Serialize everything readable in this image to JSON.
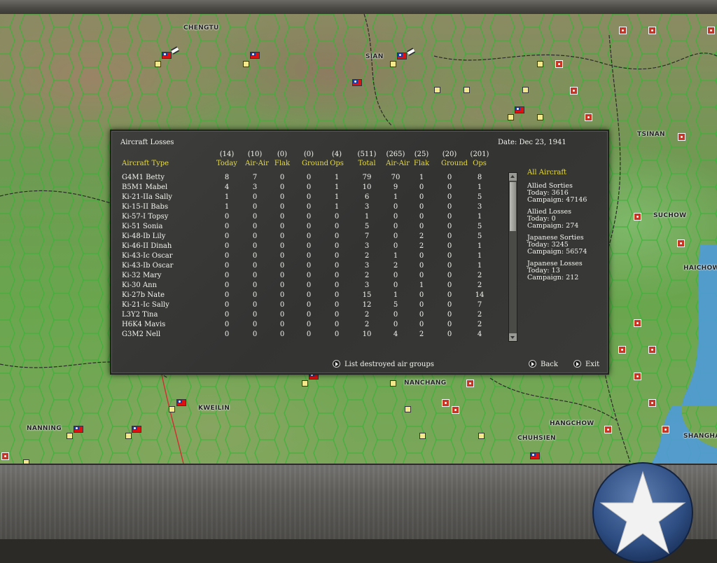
{
  "map": {
    "cities": [
      "CHENGTU",
      "SIAN",
      "TSINAN",
      "SUCHOW",
      "HAICHOW",
      "KWEILIN",
      "NANNING",
      "HANGCHOW",
      "CHUHSIEN",
      "SHANGHAI",
      "NANCHANG"
    ]
  },
  "dialog": {
    "title": "Aircraft Losses",
    "date": "Date: Dec 23, 1941",
    "header": {
      "aircraft_type": "Aircraft Type",
      "today_counts": [
        "(14)",
        "(10)",
        "(0)",
        "(0)",
        "(4)"
      ],
      "total_counts": [
        "(511)",
        "(265)",
        "(25)",
        "(20)",
        "(201)"
      ],
      "today_labels": [
        "Today",
        "Air-Air",
        "Flak",
        "Ground",
        "Ops"
      ],
      "total_labels": [
        "Total",
        "Air-Air",
        "Flak",
        "Ground",
        "Ops"
      ]
    },
    "rows": [
      {
        "name": "G4M1 Betty",
        "today": [
          "8",
          "7",
          "0",
          "0",
          "1"
        ],
        "total": [
          "79",
          "70",
          "1",
          "0",
          "8"
        ]
      },
      {
        "name": "B5M1 Mabel",
        "today": [
          "4",
          "3",
          "0",
          "0",
          "1"
        ],
        "total": [
          "10",
          "9",
          "0",
          "0",
          "1"
        ]
      },
      {
        "name": "Ki-21-IIa Sally",
        "today": [
          "1",
          "0",
          "0",
          "0",
          "1"
        ],
        "total": [
          "6",
          "1",
          "0",
          "0",
          "5"
        ]
      },
      {
        "name": "Ki-15-II Babs",
        "today": [
          "1",
          "0",
          "0",
          "0",
          "1"
        ],
        "total": [
          "3",
          "0",
          "0",
          "0",
          "3"
        ]
      },
      {
        "name": "Ki-57-I Topsy",
        "today": [
          "0",
          "0",
          "0",
          "0",
          "0"
        ],
        "total": [
          "1",
          "0",
          "0",
          "0",
          "1"
        ]
      },
      {
        "name": "Ki-51 Sonia",
        "today": [
          "0",
          "0",
          "0",
          "0",
          "0"
        ],
        "total": [
          "5",
          "0",
          "0",
          "0",
          "5"
        ]
      },
      {
        "name": "Ki-48-Ib Lily",
        "today": [
          "0",
          "0",
          "0",
          "0",
          "0"
        ],
        "total": [
          "7",
          "0",
          "2",
          "0",
          "5"
        ]
      },
      {
        "name": "Ki-46-II Dinah",
        "today": [
          "0",
          "0",
          "0",
          "0",
          "0"
        ],
        "total": [
          "3",
          "0",
          "2",
          "0",
          "1"
        ]
      },
      {
        "name": "Ki-43-Ic Oscar",
        "today": [
          "0",
          "0",
          "0",
          "0",
          "0"
        ],
        "total": [
          "2",
          "1",
          "0",
          "0",
          "1"
        ]
      },
      {
        "name": "Ki-43-Ib Oscar",
        "today": [
          "0",
          "0",
          "0",
          "0",
          "0"
        ],
        "total": [
          "3",
          "2",
          "0",
          "0",
          "1"
        ]
      },
      {
        "name": "Ki-32 Mary",
        "today": [
          "0",
          "0",
          "0",
          "0",
          "0"
        ],
        "total": [
          "2",
          "0",
          "0",
          "0",
          "2"
        ]
      },
      {
        "name": "Ki-30 Ann",
        "today": [
          "0",
          "0",
          "0",
          "0",
          "0"
        ],
        "total": [
          "3",
          "0",
          "1",
          "0",
          "2"
        ]
      },
      {
        "name": "Ki-27b Nate",
        "today": [
          "0",
          "0",
          "0",
          "0",
          "0"
        ],
        "total": [
          "15",
          "1",
          "0",
          "0",
          "14"
        ]
      },
      {
        "name": "Ki-21-Ic Sally",
        "today": [
          "0",
          "0",
          "0",
          "0",
          "0"
        ],
        "total": [
          "12",
          "5",
          "0",
          "0",
          "7"
        ]
      },
      {
        "name": "L3Y2 Tina",
        "today": [
          "0",
          "0",
          "0",
          "0",
          "0"
        ],
        "total": [
          "2",
          "0",
          "0",
          "0",
          "2"
        ]
      },
      {
        "name": "H6K4 Mavis",
        "today": [
          "0",
          "0",
          "0",
          "0",
          "0"
        ],
        "total": [
          "2",
          "0",
          "0",
          "0",
          "2"
        ]
      },
      {
        "name": "G3M2 Nell",
        "today": [
          "0",
          "0",
          "0",
          "0",
          "0"
        ],
        "total": [
          "10",
          "4",
          "2",
          "0",
          "4"
        ]
      }
    ],
    "summary": {
      "heading": "All Aircraft",
      "allied_sorties": {
        "title": "Allied Sorties",
        "today": "Today:   3616",
        "campaign": "Campaign: 47146"
      },
      "allied_losses": {
        "title": "Allied Losses",
        "today": "Today:   0",
        "campaign": "Campaign: 274"
      },
      "japanese_sorties": {
        "title": "Japanese Sorties",
        "today": "Today:   3245",
        "campaign": "Campaign: 56574"
      },
      "japanese_losses": {
        "title": "Japanese Losses",
        "today": "Today:   13",
        "campaign": "Campaign: 212"
      }
    },
    "buttons": {
      "list_destroyed": "List destroyed air groups",
      "back": "Back",
      "exit": "Exit"
    }
  },
  "colors": {
    "header_accent": "#e8dc3c",
    "dialog_bg": "#383837",
    "text": "#f4f4f0"
  }
}
